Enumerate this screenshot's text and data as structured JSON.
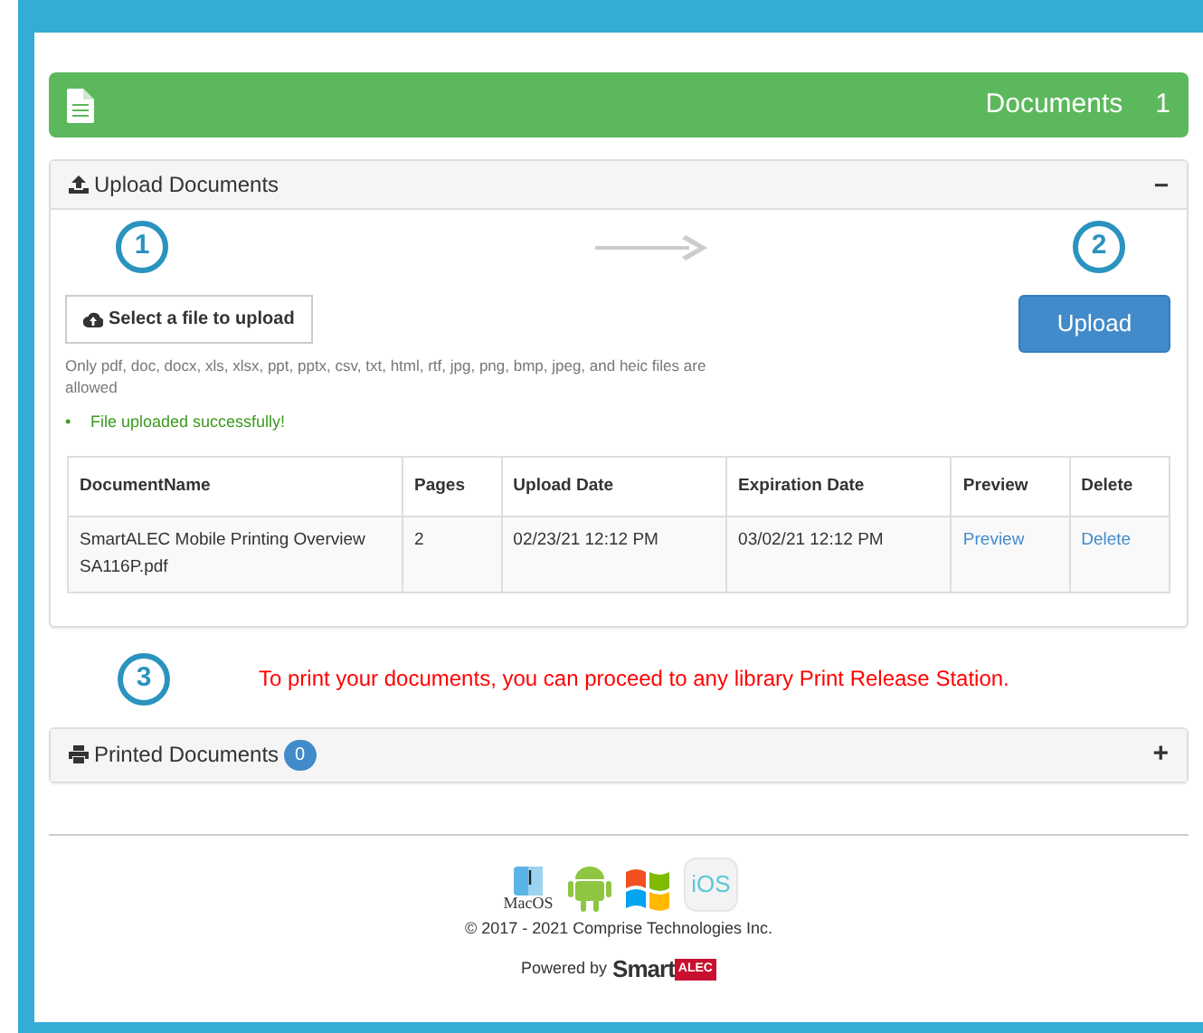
{
  "header": {
    "title": "Documents",
    "count": "1"
  },
  "upload_panel": {
    "title": "Upload Documents",
    "expanded": true,
    "toggle": "−",
    "steps": [
      "1",
      "2"
    ],
    "select_button": "Select a file to upload",
    "upload_button": "Upload",
    "help": "Only pdf, doc, docx, xls, xlsx, ppt, pptx, csv, txt, html, rtf, jpg, png, bmp, jpeg, and heic files are allowed",
    "messages": [
      {
        "bullet": "•",
        "text": "File uploaded successfully!"
      }
    ],
    "table": {
      "columns": [
        "DocumentName",
        "Pages",
        "Upload Date",
        "Expiration Date",
        "Preview",
        "Delete"
      ],
      "rows": [
        {
          "name": "SmartALEC Mobile Printing Overview SA116P.pdf",
          "pages": "2",
          "upload_date": "02/23/21 12:12 PM",
          "expiration_date": "03/02/21 12:12 PM",
          "preview": "Preview",
          "delete": "Delete"
        }
      ]
    }
  },
  "step3": {
    "number": "3",
    "message": "To print your documents, you can proceed to any library Print Release Station."
  },
  "printed_panel": {
    "title": "Printed Documents",
    "count": "0",
    "expanded": false,
    "toggle": "+"
  },
  "footer": {
    "macos_label": "MacOS",
    "ios_label": "iOS",
    "copyright": "© 2017 - 2021 Comprise Technologies Inc.",
    "powered_by": "Powered by",
    "brand": "Smart",
    "brand_tag": "ALEC"
  }
}
